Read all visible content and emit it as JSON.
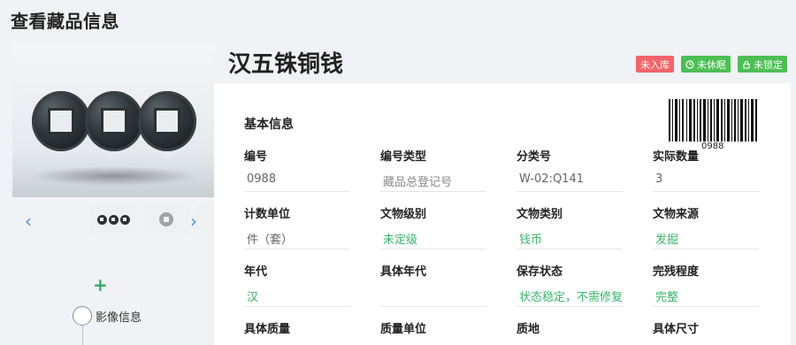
{
  "page": {
    "title": "查看藏品信息"
  },
  "gallery": {
    "prev_icon": "chevron-left-icon",
    "next_icon": "chevron-right-icon",
    "prev_glyph": "‹",
    "next_glyph": "›"
  },
  "sidebar": {
    "add_glyph": "+",
    "timeline_label": "影像信息"
  },
  "item": {
    "title": "汉五铢铜钱",
    "badges": [
      {
        "label": "未入库",
        "color": "#f2656a",
        "icon": ""
      },
      {
        "label": "未休眠",
        "color": "#4cbf54",
        "icon": "clock-icon"
      },
      {
        "label": "未锁定",
        "color": "#4cbf54",
        "icon": "lock-icon"
      }
    ]
  },
  "info": {
    "section_title": "基本信息",
    "barcode_text": "0988",
    "rows": [
      [
        {
          "label": "编号",
          "value": "0988"
        },
        {
          "label": "编号类型",
          "value": "藏品总登记号"
        },
        {
          "label": "分类号",
          "value": "W-02:Q141"
        },
        {
          "label": "实际数量",
          "value": "3"
        }
      ],
      [
        {
          "label": "计数单位",
          "value": "件（套）"
        },
        {
          "label": "文物级别",
          "value": "未定级"
        },
        {
          "label": "文物类别",
          "value": "钱币"
        },
        {
          "label": "文物来源",
          "value": "发掘"
        }
      ],
      [
        {
          "label": "年代",
          "value": "汉"
        },
        {
          "label": "具体年代",
          "value": ""
        },
        {
          "label": "保存状态",
          "value": "状态稳定，不需修复"
        },
        {
          "label": "完残程度",
          "value": "完整"
        }
      ],
      [
        {
          "label": "具体质量",
          "value": ""
        },
        {
          "label": "质量单位",
          "value": ""
        },
        {
          "label": "质地",
          "value": ""
        },
        {
          "label": "具体尺寸",
          "value": ""
        }
      ]
    ]
  },
  "colors": {
    "accent_green": "#3bb36a",
    "badge_red": "#f2656a",
    "badge_green": "#4cbf54",
    "nav_blue": "#4a8fe0"
  }
}
